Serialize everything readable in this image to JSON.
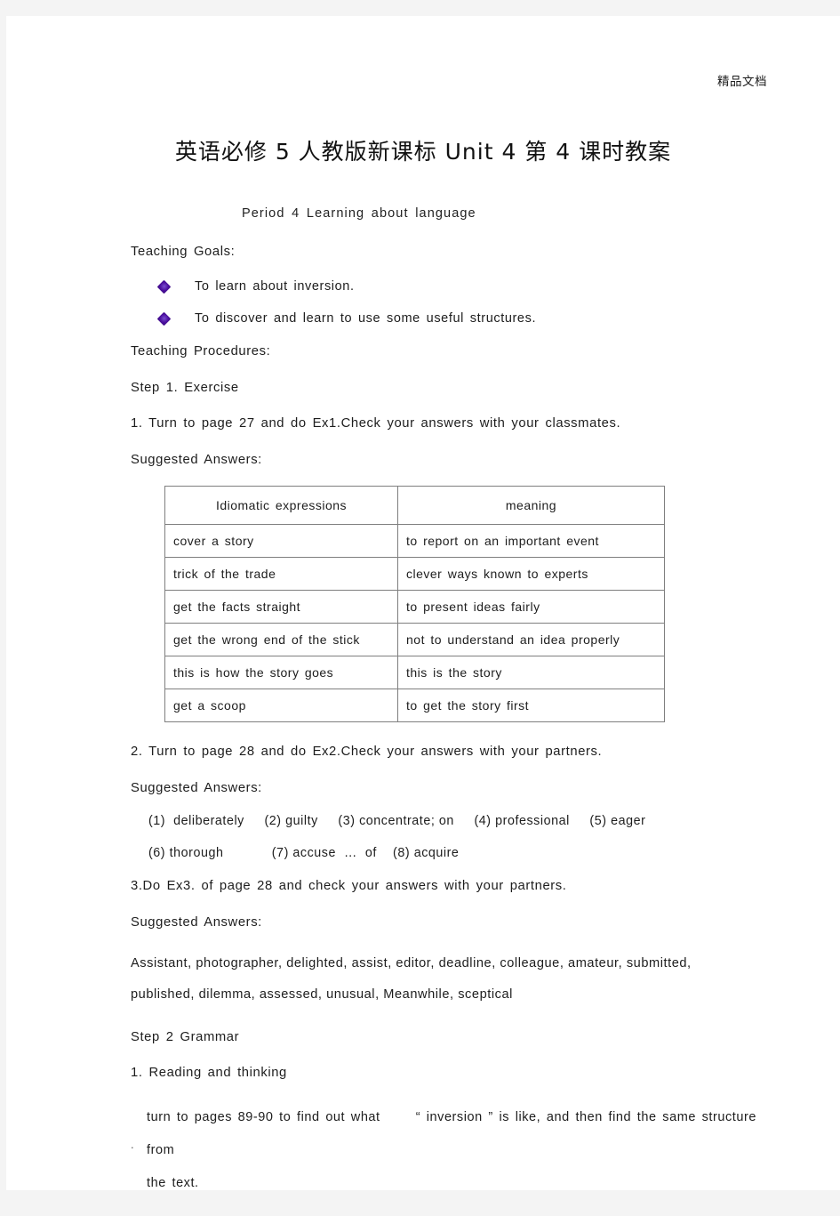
{
  "header": {
    "watermark": "精品文档"
  },
  "title": {
    "full": "英语必修 5 人教版新课标  Unit 4 第 4 课时教案"
  },
  "subtitle": "Period 4    Learning about language",
  "sections": {
    "teaching_goals_label": "Teaching Goals:",
    "goals": [
      "To learn about inversion.",
      "To discover and learn to use some useful structures."
    ],
    "teaching_procedures_label": "Teaching Procedures:",
    "step1_label": "Step 1. Exercise",
    "ex1_instruction": "1. Turn to page 27 and do Ex1.Check your answers with your classmates.",
    "suggested_answers_label_1": "Suggested Answers:",
    "ex2_instruction": "2. Turn to page 28 and do Ex2.Check your answers with your partners.",
    "suggested_answers_label_2": "Suggested Answers:",
    "ex2_answers_line1": "(1)  deliberately     (2) guilty     (3) concentrate; on     (4) professional     (5) eager",
    "ex2_answers_line2": "(6) thorough            (7) accuse  …  of    (8) acquire",
    "ex3_instruction": "3.Do Ex3. of page 28 and check your answers with your partners.",
    "suggested_answers_label_3": "Suggested Answers:",
    "ex3_answers_line1": "Assistant,   photographer,   delighted,   assist,  editor,  deadline,  colleague,  amateur,  submitted,",
    "ex3_answers_line2": "published, dilemma, assessed, unusual, Meanwhile, sceptical",
    "step2_label": "Step 2 Grammar",
    "grammar_item1": "1. Reading and thinking",
    "grammar_detail": "turn to pages 89-90 to find out what      “ inversion ” is like, and then find the same structure from\nthe text."
  },
  "table": {
    "headers": [
      "Idiomatic expressions",
      "meaning"
    ],
    "rows": [
      [
        "cover a story",
        "to report on an important event"
      ],
      [
        "trick of the trade",
        "clever ways known to experts"
      ],
      [
        "get the facts straight",
        "to present ideas fairly"
      ],
      [
        "get the wrong end of the stick",
        "not to understand an idea properly"
      ],
      [
        "this is how the story goes",
        "this is the story"
      ],
      [
        "get a scoop",
        "to get the story first"
      ]
    ]
  },
  "footer": {
    "mark": "."
  },
  "colors": {
    "page_background": "#ffffff",
    "canvas_background": "#f4f4f4",
    "text": "#1d1d1d",
    "bullet": "#4b0f9e",
    "table_border": "#7f7f7f"
  }
}
